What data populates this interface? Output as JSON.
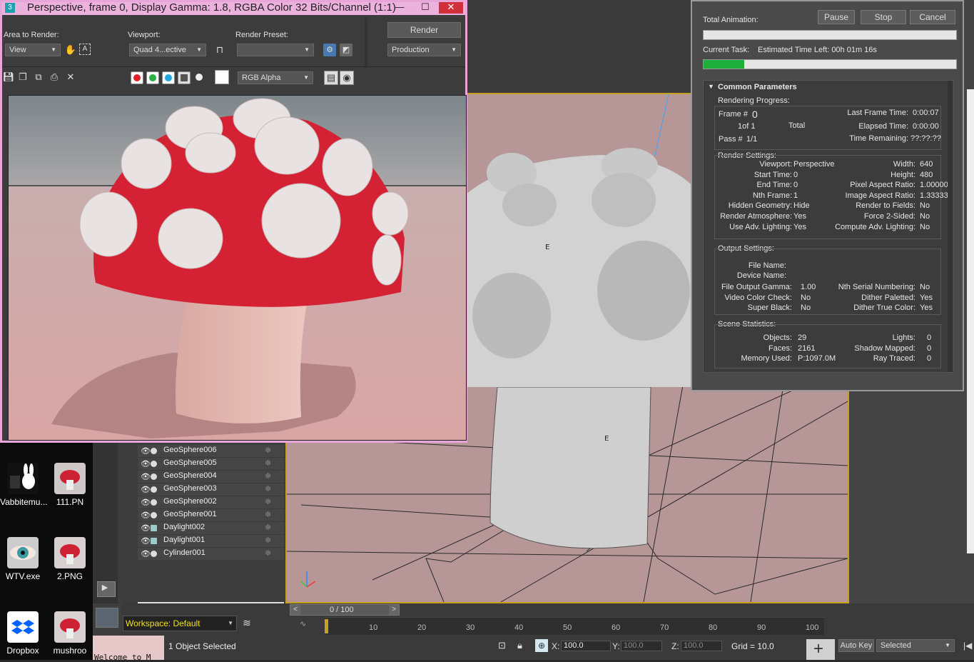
{
  "render_frame": {
    "title": "Perspective, frame 0, Display Gamma: 1.8, RGBA Color 32 Bits/Channel (1:1)",
    "app_icon": "3",
    "area_label": "Area to Render:",
    "area_value": "View",
    "viewport_label": "Viewport:",
    "viewport_value": "Quad 4...ective",
    "preset_label": "Render Preset:",
    "preset_value": "",
    "render_button": "Render",
    "production_value": "Production",
    "channel_value": "RGB Alpha"
  },
  "rendering_progress": {
    "total_animation_label": "Total Animation:",
    "pause": "Pause",
    "stop": "Stop",
    "cancel": "Cancel",
    "total_progress": 0.0,
    "current_task_label": "Current Task:",
    "current_task_value": "Estimated Time Left: 00h 01m 16s",
    "task_progress": 0.16,
    "section_title": "Common Parameters",
    "progress": {
      "title": "Rendering Progress:",
      "frame_label": "Frame #",
      "frame_value": "0",
      "of_value": "1of 1",
      "total_label": "Total",
      "pass_label": "Pass #",
      "pass_value": "1/1",
      "last_frame_label": "Last Frame Time:",
      "last_frame_value": "0:00:07",
      "elapsed_label": "Elapsed Time:",
      "elapsed_value": "0:00:00",
      "remaining_label": "Time Remaining:",
      "remaining_value": "??:??:??"
    },
    "render_settings": {
      "title": "Render Settings:",
      "left": [
        {
          "k": "Viewport:",
          "v": "Perspective"
        },
        {
          "k": "Start Time:",
          "v": "0"
        },
        {
          "k": "End Time:",
          "v": "0"
        },
        {
          "k": "Nth Frame:",
          "v": "1"
        },
        {
          "k": "Hidden Geometry:",
          "v": "Hide"
        },
        {
          "k": "Render Atmosphere:",
          "v": "Yes"
        },
        {
          "k": "Use Adv. Lighting:",
          "v": "Yes"
        }
      ],
      "right": [
        {
          "k": "Width:",
          "v": "640"
        },
        {
          "k": "Height:",
          "v": "480"
        },
        {
          "k": "Pixel Aspect Ratio:",
          "v": "1.00000"
        },
        {
          "k": "Image Aspect Ratio:",
          "v": "1.33333"
        },
        {
          "k": "Render to Fields:",
          "v": "No"
        },
        {
          "k": "Force 2-Sided:",
          "v": "No"
        },
        {
          "k": "Compute Adv. Lighting:",
          "v": "No"
        }
      ]
    },
    "output_settings": {
      "title": "Output Settings:",
      "file_name_label": "File Name:",
      "device_name_label": "Device Name:",
      "left": [
        {
          "k": "File Output Gamma:",
          "v": "1.00"
        },
        {
          "k": "Video Color Check:",
          "v": "No"
        },
        {
          "k": "Super Black:",
          "v": "No"
        }
      ],
      "right": [
        {
          "k": "Nth Serial Numbering:",
          "v": "No"
        },
        {
          "k": "Dither Paletted:",
          "v": "Yes"
        },
        {
          "k": "Dither True Color:",
          "v": "Yes"
        }
      ]
    },
    "scene_statistics": {
      "title": "Scene Statistics:",
      "left": [
        {
          "k": "Objects:",
          "v": "29"
        },
        {
          "k": "Faces:",
          "v": "2161"
        },
        {
          "k": "Memory Used:",
          "v": "P:1097.0M"
        }
      ],
      "right": [
        {
          "k": "Lights:",
          "v": "0"
        },
        {
          "k": "Shadow Mapped:",
          "v": "0"
        },
        {
          "k": "Ray Traced:",
          "v": "0"
        }
      ]
    }
  },
  "scene_explorer": {
    "rows": [
      {
        "name": "GeoSphere006",
        "type": "geo"
      },
      {
        "name": "GeoSphere005",
        "type": "geo"
      },
      {
        "name": "GeoSphere004",
        "type": "geo"
      },
      {
        "name": "GeoSphere003",
        "type": "geo"
      },
      {
        "name": "GeoSphere002",
        "type": "geo"
      },
      {
        "name": "GeoSphere001",
        "type": "geo"
      },
      {
        "name": "Daylight002",
        "type": "light"
      },
      {
        "name": "Daylight001",
        "type": "light"
      },
      {
        "name": "Cylinder001",
        "type": "geo"
      }
    ],
    "workspace": "Workspace: Default"
  },
  "timeline": {
    "frame_counter": "0 / 100",
    "ticks": [
      "10",
      "20",
      "30",
      "40",
      "50",
      "60",
      "70",
      "80",
      "90",
      "100"
    ]
  },
  "status": {
    "selection": "1 Object Selected",
    "x_label": "X:",
    "x_value": "100.0",
    "y_label": "Y:",
    "y_value": "100.0",
    "z_label": "Z:",
    "z_value": "100.0",
    "grid": "Grid = 10.0",
    "auto_key": "Auto Key",
    "selected_value": "Selected",
    "listener_text": "Welcome to M"
  },
  "desktop": {
    "icons": [
      {
        "label": "Vabbitemu..."
      },
      {
        "label": "111.PN"
      },
      {
        "label": "WTV.exe"
      },
      {
        "label": "2.PNG"
      },
      {
        "label": "Dropbox"
      },
      {
        "label": "mushroo"
      }
    ]
  },
  "colors": {
    "accent_pink": "#ecb1dd",
    "progress_green": "#1fb03c",
    "viewport_bg": "#b69696",
    "workspace_text": "#f0e020"
  }
}
